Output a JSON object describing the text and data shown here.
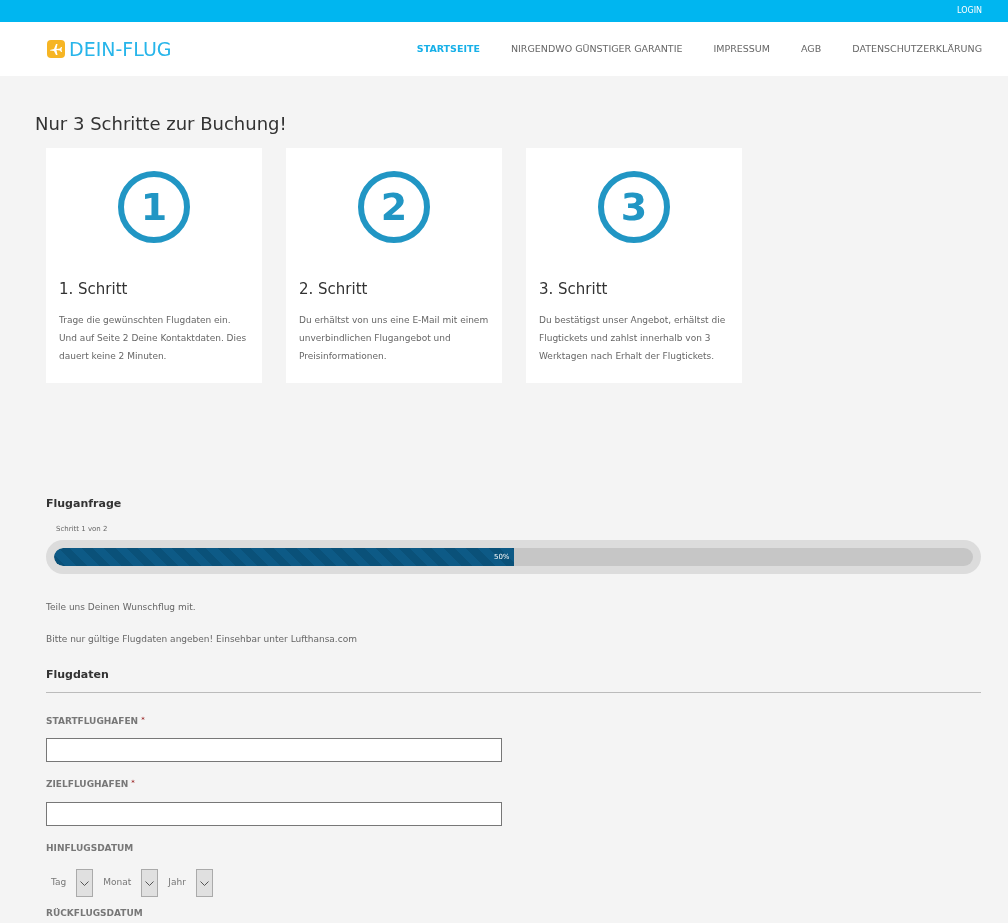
{
  "topbar": {
    "login": "LOGIN"
  },
  "header": {
    "logo": "DEIN-FLUG",
    "nav": [
      {
        "label": "STARTSEITE",
        "selected": true
      },
      {
        "label": "NIRGENDWO GÜNSTIGER GARANTIE",
        "selected": false
      },
      {
        "label": "IMPRESSUM",
        "selected": false
      },
      {
        "label": "AGB",
        "selected": false
      },
      {
        "label": "DATENSCHUTZERKLÄRUNG",
        "selected": false
      }
    ]
  },
  "heading": "Nur 3 Schritte zur Buchung!",
  "steps": [
    {
      "number": "1",
      "title": "1. Schritt",
      "text": "Trage die gewünschten Flugdaten ein. Und auf Seite 2 Deine Kontaktdaten. Dies dauert keine 2 Minuten."
    },
    {
      "number": "2",
      "title": "2. Schritt",
      "text": "Du erhältst von uns eine E-Mail mit einem unverbindlichen Flugangebot und Preisinformationen."
    },
    {
      "number": "3",
      "title": "3. Schritt",
      "text": "Du bestätigst unser Angebot, erhältst die Flugtickets und zahlst innerhalb von 3 Werktagen nach Erhalt der Flugtickets."
    }
  ],
  "form": {
    "title": "Fluganfrage",
    "step_label": "Schritt 1 von 2",
    "progress": {
      "level": 0.5,
      "reading": "50%"
    },
    "intro": [
      "Teile uns Deinen Wunschflug mit.",
      "Bitte nur gültige Flugdaten angeben! Einsehbar unter Lufthansa.com"
    ],
    "section": "Flugdaten",
    "fields": [
      {
        "kind": "text",
        "label": "STARTFLUGHAFEN",
        "required_mark": "*"
      },
      {
        "kind": "text",
        "label": "ZIELFLUGHAFEN",
        "required_mark": "*"
      },
      {
        "kind": "date",
        "label": "HINFLUGSDATUM",
        "parts": [
          "Tag",
          "Monat",
          "Jahr"
        ]
      },
      {
        "kind": "heading",
        "label": "RÜCKFLUGSDATUM"
      }
    ]
  }
}
